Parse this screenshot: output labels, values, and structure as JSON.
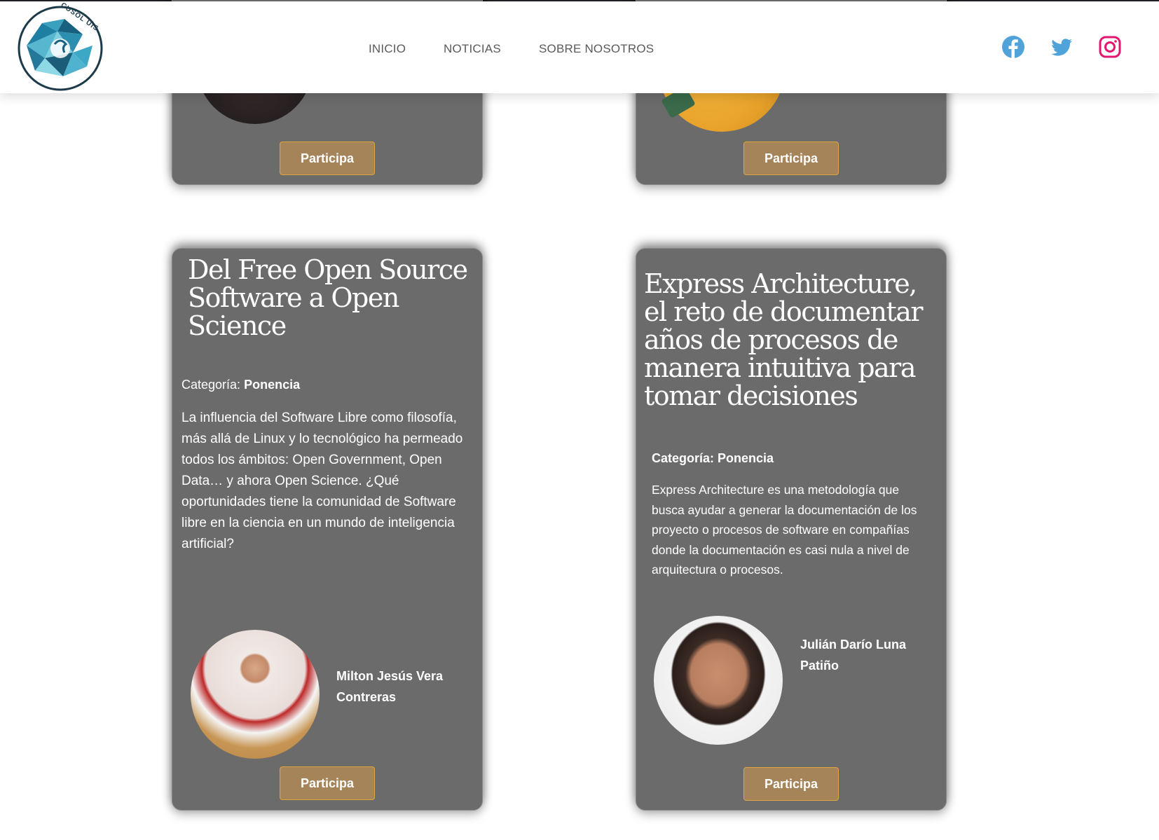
{
  "header": {
    "logo_text": "CUSOL UIS",
    "nav": [
      "INICIO",
      "NOTICIAS",
      "SOBRE NOSOTROS"
    ],
    "social": {
      "facebook": {
        "icon": "facebook-icon",
        "color": "#4fa3d9"
      },
      "twitter": {
        "icon": "twitter-icon",
        "color": "#4fa3d9"
      },
      "instagram": {
        "icon": "instagram-icon",
        "color": "#e5166f"
      }
    }
  },
  "colors": {
    "card_bg": "#6b6b6b",
    "button_bg": "#a5845a",
    "button_border": "#e0a53f"
  },
  "cards_top": [
    {
      "button": "Participa"
    },
    {
      "button": "Participa"
    }
  ],
  "cards": [
    {
      "title": "Del Free Open Source Software a Open Science",
      "category_label": "Categoría:",
      "category_value": "Ponencia",
      "description": "La influencia del Software Libre como filosofía, más allá de Linux y lo tecnológico ha permeado todos los ámbitos: Open Government, Open Data… y ahora Open Science. ¿Qué oportunidades tiene la comunidad de Software libre en la ciencia en un mundo de inteligencia artificial?",
      "speaker": "Milton Jesús Vera Contreras",
      "button": "Participa"
    },
    {
      "title": "Express Architecture, el reto de documentar años de procesos de manera intuitiva para tomar decisiones",
      "category_label": "Categoría:",
      "category_value": "Ponencia",
      "description": "Express Architecture es una metodología que busca ayudar a generar la documentación de los proyecto o procesos de software en compañías donde la documentación es casi nula a nivel de arquitectura o procesos.",
      "speaker": "Julián Darío Luna Patiño",
      "button": "Participa"
    }
  ]
}
